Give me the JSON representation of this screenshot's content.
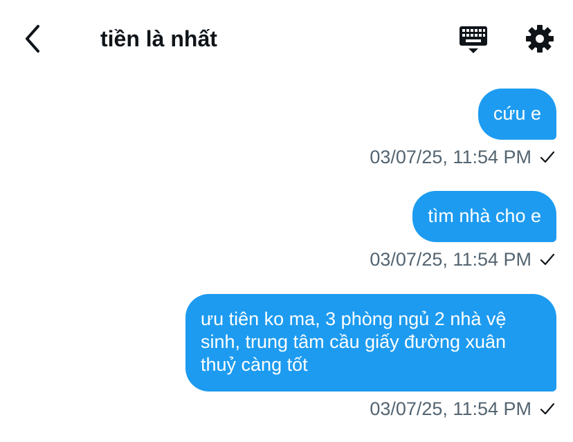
{
  "header": {
    "title": "tiền là nhất",
    "icons": {
      "back": "chevron-left-icon",
      "keyboard": "keyboard-icon",
      "settings": "gear-icon"
    }
  },
  "messages": [
    {
      "text": "cứu e",
      "timestamp": "03/07/25, 11:54 PM",
      "status_icon": "checkmark-icon"
    },
    {
      "text": "tìm nhà cho e",
      "timestamp": "03/07/25, 11:54 PM",
      "status_icon": "checkmark-icon"
    },
    {
      "text": "ưu tiên ko ma, 3 phòng ngủ 2 nhà vệ sinh, trung tâm cầu giấy đường xuân thuỷ càng tốt",
      "timestamp": "03/07/25, 11:54 PM",
      "status_icon": "checkmark-icon"
    }
  ],
  "colors": {
    "bubble": "#1d9bf0",
    "bubble_text": "#ffffff",
    "timestamp_text": "#536471",
    "title_text": "#0f1419"
  }
}
